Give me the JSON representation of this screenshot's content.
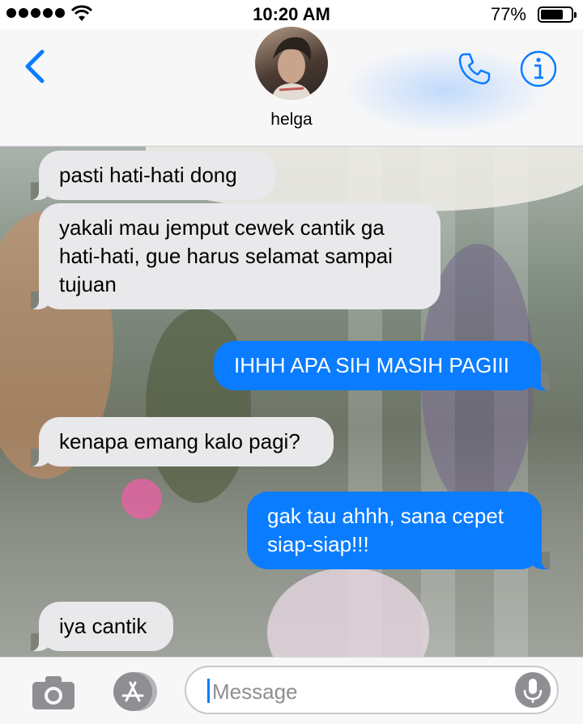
{
  "status_bar": {
    "time": "10:20 AM",
    "battery_percent": "77%",
    "battery_level": 0.77
  },
  "header": {
    "contact_name": "helga",
    "back_icon": "chevron-left-icon",
    "call_icon": "phone-icon",
    "info_icon": "info-icon"
  },
  "messages": [
    {
      "direction": "incoming",
      "text": "pasti hati-hati dong"
    },
    {
      "direction": "incoming",
      "text": "yakali mau jemput cewek cantik ga hati-hati, gue harus selamat sampai tujuan"
    },
    {
      "direction": "outgoing",
      "text": "IHHH APA SIH MASIH PAGIII"
    },
    {
      "direction": "incoming",
      "text": "kenapa emang kalo pagi?"
    },
    {
      "direction": "outgoing",
      "text": "gak tau ahhh, sana cepet siap-siap!!!"
    },
    {
      "direction": "incoming",
      "text": "iya cantik"
    }
  ],
  "input_bar": {
    "placeholder": "Message",
    "camera_icon": "camera-icon",
    "apps_icon": "app-store-icon",
    "mic_icon": "microphone-icon"
  },
  "colors": {
    "accent": "#0a7cff",
    "incoming_bubble": "#e9e9eb",
    "background": "#f7f7f8"
  }
}
